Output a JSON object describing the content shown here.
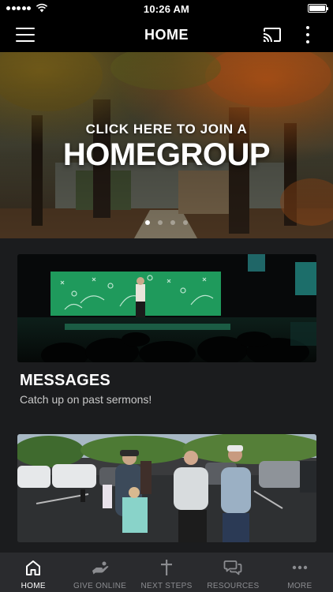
{
  "status_bar": {
    "time": "10:26 AM",
    "signal_icon": "signal-dots-icon",
    "wifi_icon": "wifi-icon",
    "battery_icon": "battery-icon",
    "battery_level": 1.0
  },
  "header": {
    "title": "HOME",
    "menu_icon": "hamburger-menu-icon",
    "cast_icon": "cast-icon",
    "more_icon": "more-vertical-icon"
  },
  "hero": {
    "kicker": "CLICK HERE TO JOIN A",
    "title": "HOMEGROUP",
    "slide_count": 4,
    "active_slide": 1
  },
  "cards": [
    {
      "title": "MESSAGES",
      "subtitle": "Catch up on past sermons!"
    },
    {
      "title": "",
      "subtitle": ""
    }
  ],
  "tabs": [
    {
      "label": "HOME",
      "icon": "home-icon",
      "active": true
    },
    {
      "label": "GIVE ONLINE",
      "icon": "give-hand-icon",
      "active": false
    },
    {
      "label": "NEXT STEPS",
      "icon": "cross-icon",
      "active": false
    },
    {
      "label": "RESOURCES",
      "icon": "chat-bubbles-icon",
      "active": false
    },
    {
      "label": "MORE",
      "icon": "more-horizontal-icon",
      "active": false
    }
  ],
  "colors": {
    "background": "#1b1c1e",
    "header": "#000000",
    "tab_bar": "#2a2b2e",
    "tab_inactive": "#8b8c90",
    "tab_active": "#ffffff"
  }
}
